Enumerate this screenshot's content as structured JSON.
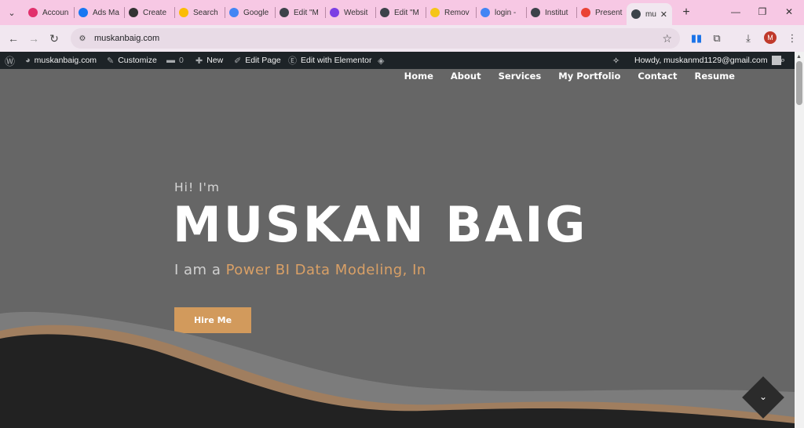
{
  "browser": {
    "tabs": [
      {
        "label": "Accoun",
        "icon": "instagram-icon",
        "color": "#e1306c"
      },
      {
        "label": "Ads Ma",
        "icon": "meta-icon",
        "color": "#1877f2"
      },
      {
        "label": "Create",
        "icon": "openai-icon",
        "color": "#333333"
      },
      {
        "label": "Search",
        "icon": "google-ads-icon",
        "color": "#fbbc04"
      },
      {
        "label": "Google",
        "icon": "gemini-icon",
        "color": "#4285f4"
      },
      {
        "label": "Edit \"M",
        "icon": "wordpress-icon",
        "color": "#3c434a"
      },
      {
        "label": "Websit",
        "icon": "website-icon",
        "color": "#7b3fe4"
      },
      {
        "label": "Edit \"M",
        "icon": "wordpress-icon",
        "color": "#3c434a"
      },
      {
        "label": "Remov",
        "icon": "remove-bg-icon",
        "color": "#f5c518"
      },
      {
        "label": "login -",
        "icon": "google-icon",
        "color": "#4285f4"
      },
      {
        "label": "Institut",
        "icon": "globe-icon",
        "color": "#3c434a"
      },
      {
        "label": "Present",
        "icon": "gmail-icon",
        "color": "#ea4335"
      },
      {
        "label": "mu",
        "icon": "globe-icon",
        "color": "#3c434a",
        "active": true
      }
    ],
    "url": "muskanbaig.com",
    "avatar_letter": "M"
  },
  "adminbar": {
    "site_name": "muskanbaig.com",
    "customize": "Customize",
    "comments_count": "0",
    "new": "New",
    "edit_page": "Edit Page",
    "edit_elementor": "Edit with Elementor",
    "howdy": "Howdy, muskanmd1129@gmail.com"
  },
  "site": {
    "nav": [
      "Home",
      "About",
      "Services",
      "My Portfolio",
      "Contact",
      "Resume"
    ],
    "hero": {
      "greeting": "Hi! I'm",
      "name": "MUSKAN BAIG",
      "role_prefix": "I am a ",
      "role_highlight": "Power BI Data Modeling, In",
      "cta": "Hire Me"
    }
  },
  "colors": {
    "accent": "#d29a5c",
    "hero_bg": "#666666",
    "admin_bar": "#1d2327",
    "tab_strip": "#f7c8e4"
  }
}
